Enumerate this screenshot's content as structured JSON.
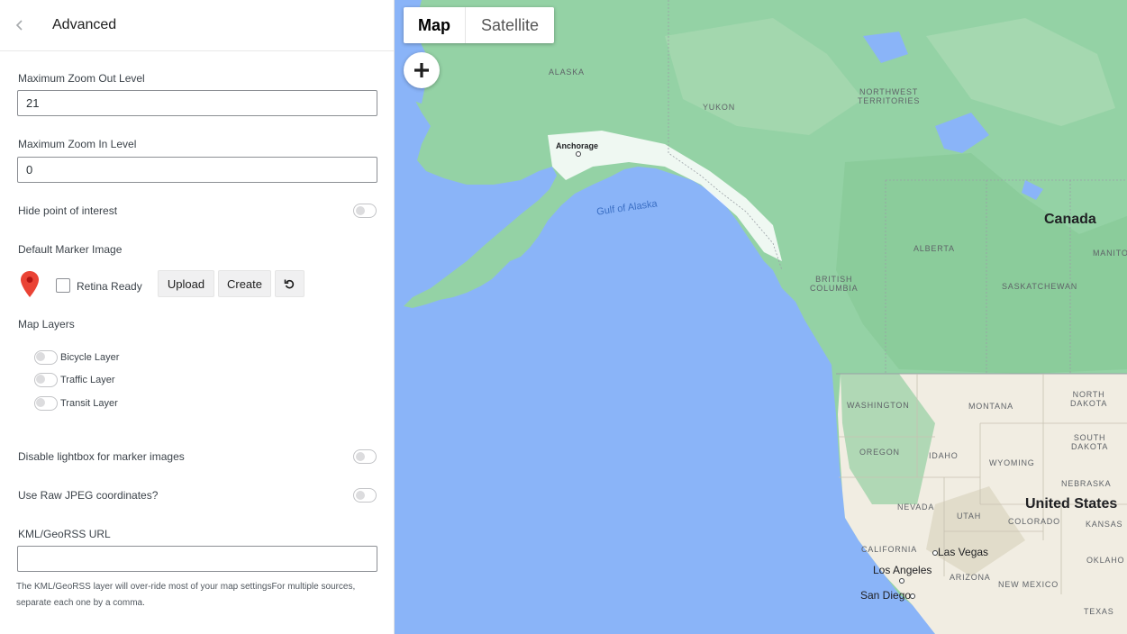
{
  "header": {
    "title": "Advanced"
  },
  "fields": {
    "zoom_out": {
      "label": "Maximum Zoom Out Level",
      "value": "21"
    },
    "zoom_in": {
      "label": "Maximum Zoom In Level",
      "value": "0"
    },
    "hide_poi": {
      "label": "Hide point of interest",
      "enabled": false
    },
    "marker_image": {
      "label": "Default Marker Image",
      "retina_label": "Retina Ready",
      "upload_label": "Upload",
      "create_label": "Create",
      "pin_color": "#ea4335"
    },
    "layers": {
      "label": "Map Layers",
      "items": [
        {
          "label": "Bicycle Layer",
          "enabled": false
        },
        {
          "label": "Traffic Layer",
          "enabled": false
        },
        {
          "label": "Transit Layer",
          "enabled": false
        }
      ]
    },
    "disable_lightbox": {
      "label": "Disable lightbox for marker images",
      "enabled": false
    },
    "raw_jpeg": {
      "label": "Use Raw JPEG coordinates?",
      "enabled": false
    },
    "kml": {
      "label": "KML/GeoRSS URL",
      "value": "",
      "help_line1": "The KML/GeoRSS layer will over-ride most of your map settingsFor multiple sources,",
      "help_line2": "separate each one by a comma."
    }
  },
  "map": {
    "type_map": "Map",
    "type_satellite": "Satellite",
    "water_color": "#8ab4f8",
    "land_color": "#94d2a5",
    "labels": {
      "alaska": "ALASKA",
      "yukon": "YUKON",
      "nwt_1": "NORTHWEST",
      "nwt_2": "TERRITORIES",
      "anchorage": "Anchorage",
      "gulf": "Gulf of Alaska",
      "canada": "Canada",
      "alberta": "ALBERTA",
      "bc_1": "BRITISH",
      "bc_2": "COLUMBIA",
      "sask": "SASKATCHEWAN",
      "manito": "MANITO",
      "washington": "WASHINGTON",
      "montana": "MONTANA",
      "nd_1": "NORTH",
      "nd_2": "DAKOTA",
      "sd_1": "SOUTH",
      "sd_2": "DAKOTA",
      "oregon": "OREGON",
      "idaho": "IDAHO",
      "wyoming": "WYOMING",
      "nebraska": "NEBRASKA",
      "us": "United States",
      "nevada": "NEVADA",
      "utah": "UTAH",
      "colorado": "COLORADO",
      "kansas": "KANSAS",
      "california": "CALIFORNIA",
      "las_vegas": "Las Vegas",
      "los_angeles": "Los Angeles",
      "arizona": "ARIZONA",
      "san_diego": "San Diego",
      "new_mexico": "NEW MEXICO",
      "oklaho": "OKLAHO",
      "texas": "TEXAS"
    }
  }
}
